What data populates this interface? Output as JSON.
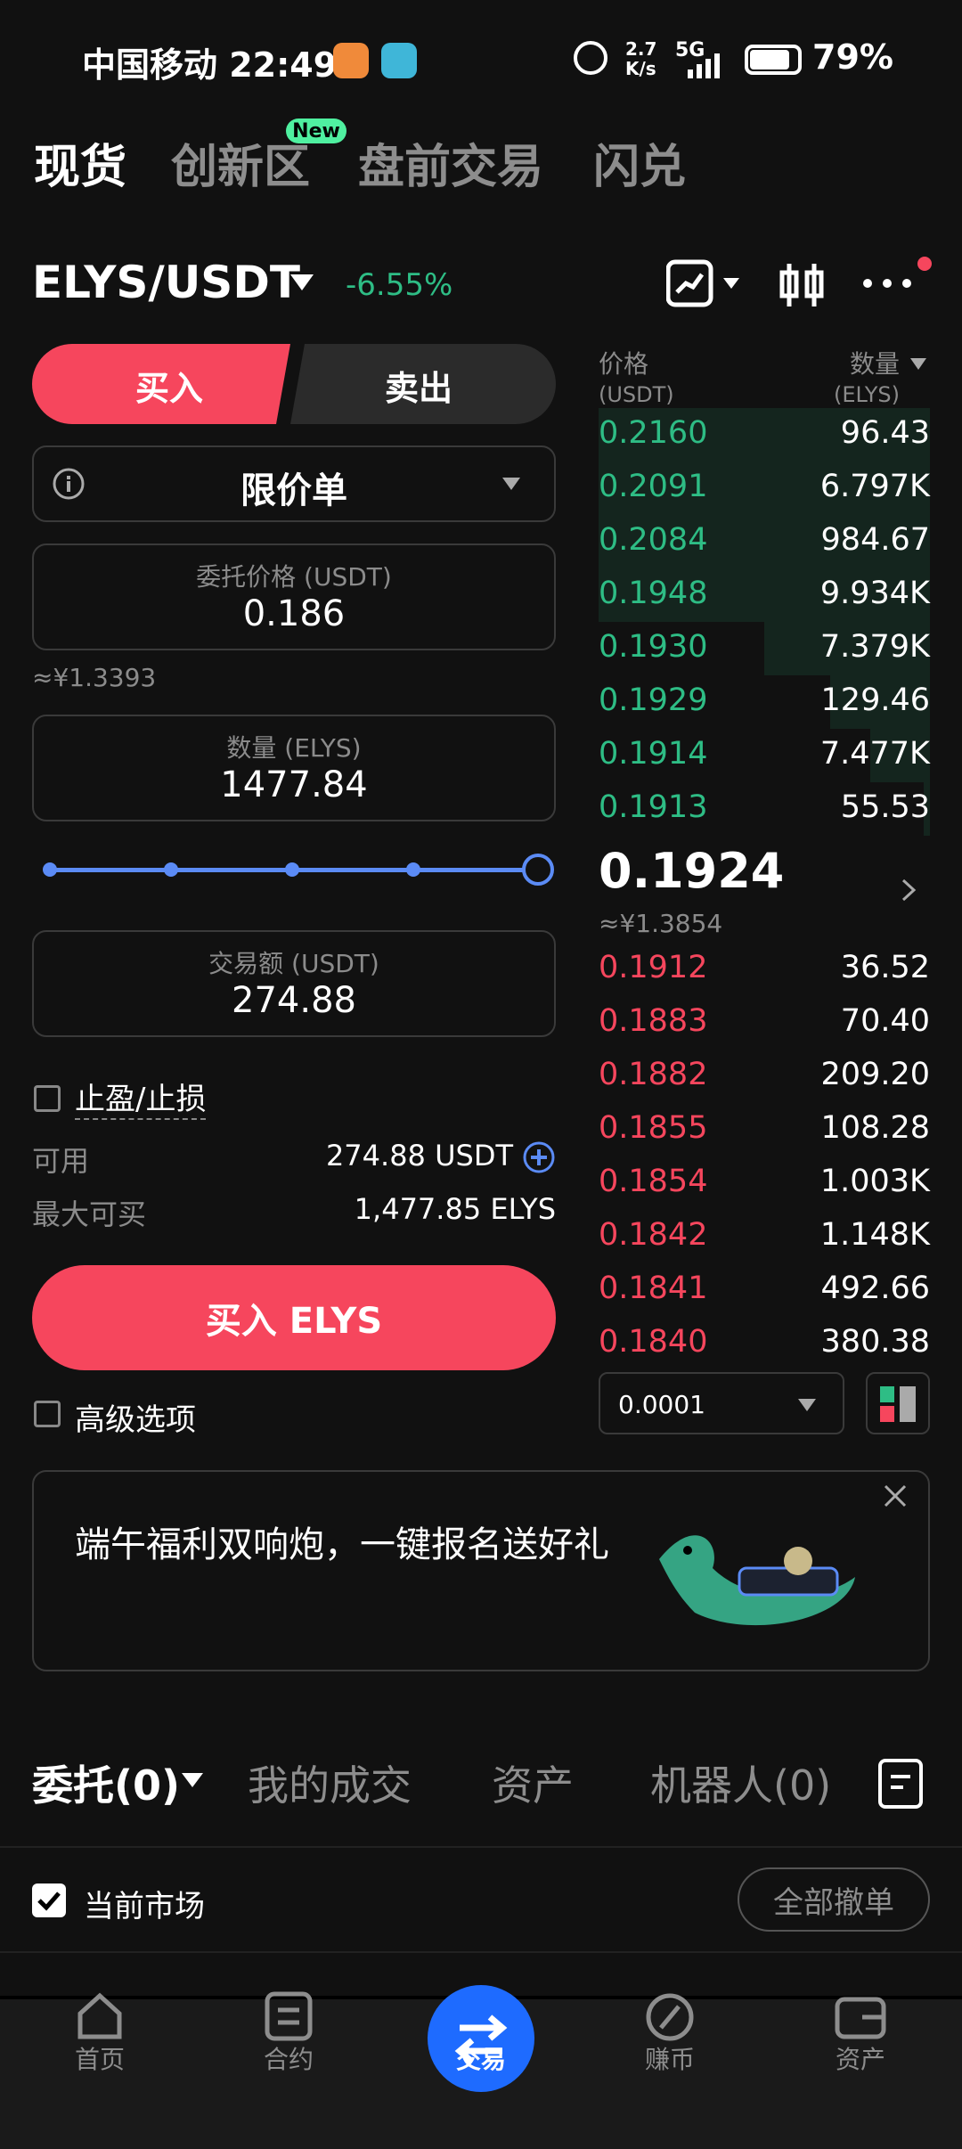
{
  "status_bar": {
    "carrier_time": "中国移动 22:49",
    "net_speed_top": "2.7",
    "net_speed_bottom": "K/s",
    "network": "5G",
    "battery": "79%"
  },
  "top_tabs": [
    {
      "label": "现货",
      "active": true
    },
    {
      "label": "创新区",
      "badge": "New"
    },
    {
      "label": "盘前交易"
    },
    {
      "label": "闪兑"
    }
  ],
  "pair": {
    "name": "ELYS/USDT",
    "change": "-6.55%"
  },
  "order_form": {
    "buy_label": "买入",
    "sell_label": "卖出",
    "order_type": "限价单",
    "price_label": "委托价格 (USDT)",
    "price_value": "0.186",
    "price_cny": "≈¥1.3393",
    "qty_label": "数量 (ELYS)",
    "qty_value": "1477.84",
    "slider_percent": 100,
    "amount_label": "交易额 (USDT)",
    "amount_value": "274.88",
    "tpsl_label": "止盈/止损",
    "available_label": "可用",
    "available_value": "274.88 USDT",
    "max_buy_label": "最大可买",
    "max_buy_value": "1,477.85 ELYS",
    "submit_label": "买入 ELYS",
    "advanced_label": "高级选项"
  },
  "orderbook": {
    "price_header": "价格",
    "price_unit": "(USDT)",
    "qty_header": "数量",
    "qty_unit": "(ELYS)",
    "asks": [
      {
        "price": "0.2160",
        "qty": "96.43",
        "depth": 1.0
      },
      {
        "price": "0.2091",
        "qty": "6.797K",
        "depth": 1.0
      },
      {
        "price": "0.2084",
        "qty": "984.67",
        "depth": 1.0
      },
      {
        "price": "0.1948",
        "qty": "9.934K",
        "depth": 1.0
      },
      {
        "price": "0.1930",
        "qty": "7.379K",
        "depth": 0.5
      },
      {
        "price": "0.1929",
        "qty": "129.46",
        "depth": 0.3
      },
      {
        "price": "0.1914",
        "qty": "7.477K",
        "depth": 0.18
      },
      {
        "price": "0.1913",
        "qty": "55.53",
        "depth": 0.02
      }
    ],
    "last_price": "0.1924",
    "last_price_cny": "≈¥1.3854",
    "bids": [
      {
        "price": "0.1912",
        "qty": "36.52"
      },
      {
        "price": "0.1883",
        "qty": "70.40"
      },
      {
        "price": "0.1882",
        "qty": "209.20"
      },
      {
        "price": "0.1855",
        "qty": "108.28"
      },
      {
        "price": "0.1854",
        "qty": "1.003K"
      },
      {
        "price": "0.1842",
        "qty": "1.148K"
      },
      {
        "price": "0.1841",
        "qty": "492.66"
      },
      {
        "price": "0.1840",
        "qty": "380.38"
      }
    ],
    "precision": "0.0001"
  },
  "banner": {
    "text": "端午福利双响炮，一键报名送好礼"
  },
  "bottom_tabs": [
    {
      "label": "委托(0)",
      "active": true
    },
    {
      "label": "我的成交"
    },
    {
      "label": "资产"
    },
    {
      "label": "机器人(0)"
    }
  ],
  "filter": {
    "current_market": "当前市场",
    "cancel_all": "全部撤单"
  },
  "bottom_nav": [
    {
      "label": "首页",
      "icon": "home-icon"
    },
    {
      "label": "合约",
      "icon": "futures-icon"
    },
    {
      "label": "交易",
      "icon": "trade-icon",
      "active": true
    },
    {
      "label": "赚币",
      "icon": "earn-icon"
    },
    {
      "label": "资产",
      "icon": "wallet-icon"
    }
  ],
  "colors": {
    "buy": "#f6465d",
    "ask_green": "#2ebd85",
    "accent_blue": "#1e6bff"
  }
}
